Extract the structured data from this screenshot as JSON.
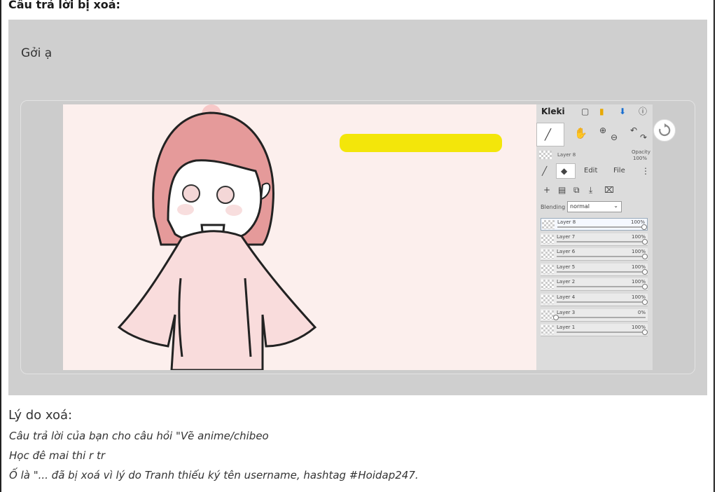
{
  "heading": "Câu trả lời bị xoá:",
  "answer": {
    "greeting": "Gởi ạ"
  },
  "kleki": {
    "brand": "Kleki",
    "current_layer": "Layer 8",
    "opacity_label": "Opacity",
    "opacity_value": "100%",
    "tabs": {
      "edit": "Edit",
      "file": "File"
    },
    "blending_label": "Blending",
    "blending_value": "normal",
    "layers": [
      {
        "name": "Layer 8",
        "opacity": "100%",
        "active": true
      },
      {
        "name": "Layer 7",
        "opacity": "100%"
      },
      {
        "name": "Layer 6",
        "opacity": "100%"
      },
      {
        "name": "Layer 5",
        "opacity": "100%"
      },
      {
        "name": "Layer 2",
        "opacity": "100%"
      },
      {
        "name": "Layer 4",
        "opacity": "100%"
      },
      {
        "name": "Layer 3",
        "opacity": "0%"
      },
      {
        "name": "Layer 1",
        "opacity": "100%"
      }
    ]
  },
  "reason": {
    "title": "Lý do xoá:",
    "lines": [
      "Câu trả lời của bạn cho câu hỏi \"Vẽ anime/chibeo",
      "Học đê mai thi r tr",
      "Ố là \"... đã bị xoá vì lý do Tranh thiếu ký tên username, hashtag #Hoidap247."
    ]
  },
  "colors": {
    "panel": "#cfcfcf",
    "canvas": "#fcefed",
    "highlight": "#f3e60a",
    "hair": "#e59a9a"
  }
}
